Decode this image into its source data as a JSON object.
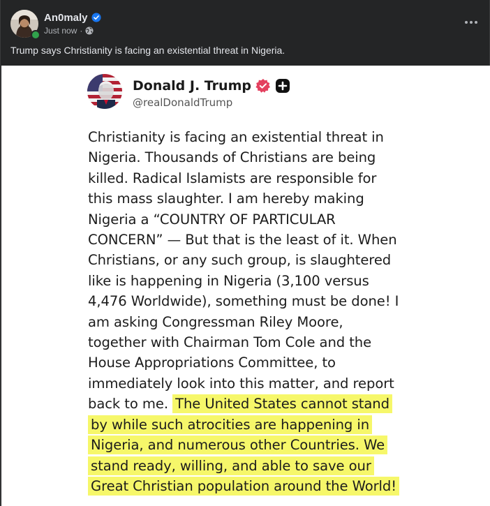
{
  "post": {
    "author": "An0maly",
    "timestamp": "Just now",
    "meta_separator": "·",
    "caption": "Trump says Christianity is facing an existential threat in Nigeria.",
    "more_icon": "more-horizontal-icon",
    "verified_icon": "verified-badge-icon",
    "globe_icon": "globe-icon"
  },
  "truth": {
    "name": "Donald J. Trump",
    "handle": "@realDonaldTrump",
    "lines_plain": [
      "Christianity is facing an existential threat in",
      "Nigeria. Thousands of Christians are being",
      "killed. Radical Islamists are responsible for",
      "this mass slaughter. I am hereby making",
      "Nigeria a “COUNTRY OF PARTICULAR",
      "CONCERN” — But that is the least of it. When",
      "Christians, or any such group, is slaughtered",
      "like is happening in Nigeria (3,100 versus",
      "4,476 Worldwide), something must be done! I",
      "am asking Congressman Riley Moore,",
      "together with Chairman Tom Cole and the",
      "House Appropriations Committee, to",
      "immediately look into this matter, and report"
    ],
    "line_14_plain": "back to me.",
    "highlighted_lines": [
      "The United States cannot stand",
      "by while such atrocities are happening in",
      "Nigeria, and numerous other Countries. We",
      "stand ready, willing, and able to save our",
      "Great Christian population around the World!"
    ],
    "highlight_color": "#f6f76a"
  },
  "colors": {
    "bg_dark": "#242526",
    "text_light": "#e4e6eb",
    "text_secondary": "#b0b3b8",
    "verified_blue": "#1877f2",
    "truth_badge_pink": "#e4405f",
    "online_green": "#31a24c"
  }
}
